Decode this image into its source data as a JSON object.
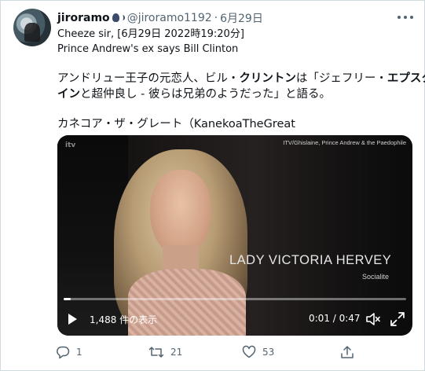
{
  "tweet": {
    "display_name": "jiroramo",
    "handle": "@jiroramo1192",
    "separator": "·",
    "date": "6月29日",
    "lines": [
      "Cheeze sir, [6月29日 2022時19:20分]",
      "Prince Andrew's ex says Bill Clinton"
    ],
    "jp_line1_a": "アンドリュー王子の元恋人、ビル・",
    "jp_line1_b": "クリントン",
    "jp_line1_c": "は「ジェフリー・",
    "jp_line1_d": "エプスタ",
    "jp_line2_a": "イン",
    "jp_line2_b": "と超仲良し - 彼らは兄弟のようだった」と語る。",
    "jp_line3": "カネコア・ザ・グレート（KanekoaTheGreat"
  },
  "video": {
    "logo": "itv",
    "credit": "ITV/Ghislaine, Prince Andrew & the Paedophile",
    "caption_name": "LADY VICTORIA HERVEY",
    "caption_role": "Socialite",
    "views": "1,488 件の表示",
    "time": "0:01 / 0:47",
    "progress": 0.02
  },
  "actions": {
    "reply_count": "1",
    "retweet_count": "21",
    "like_count": "53"
  },
  "colors": {
    "text": "#0f1419",
    "secondary": "#536471",
    "border": "#cfd9de"
  }
}
